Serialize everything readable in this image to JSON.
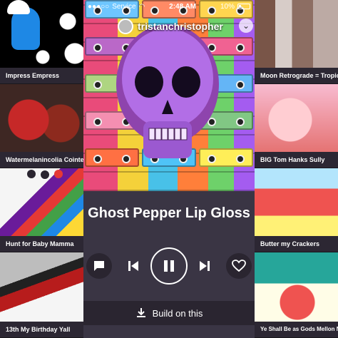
{
  "status_bar": {
    "carrier": "Service",
    "time": "2:48 AM",
    "battery": "10%"
  },
  "now_playing": {
    "username": "tristanchristopher",
    "title": "Ghost Pepper Lip Gloss",
    "build_label": "Build on this"
  },
  "icons": {
    "wifi": "wifi-icon",
    "avatar": "avatar-icon",
    "comment": "comment-icon",
    "previous": "skip-previous-icon",
    "play_pause": "pause-icon",
    "next": "skip-next-icon",
    "like": "heart-icon",
    "download": "download-icon",
    "chevron": "chevron-down-icon"
  },
  "left_tiles": [
    {
      "title": "Impress Empress",
      "colors": [
        "#1565c0",
        "#ffffff",
        "#000000"
      ]
    },
    {
      "title": "Watermelanincolia Cointel",
      "colors": [
        "#c0392b",
        "#2c1b19",
        "#e57373"
      ]
    },
    {
      "title": "Hunt for Baby Mamma",
      "colors": [
        "#6a1b9a",
        "#e53935",
        "#43a047"
      ]
    },
    {
      "title": "13th My Birthday Yall",
      "colors": [
        "#b71c1c",
        "#f5f5f5",
        "#424242"
      ]
    }
  ],
  "right_tiles": [
    {
      "title": "Moon Retrograde = Tropicoco",
      "colors": [
        "#a1887f",
        "#6d4c41",
        "#d7ccc8"
      ]
    },
    {
      "title": "BIG Tom Hanks Sully",
      "colors": [
        "#ef9a9a",
        "#c62828",
        "#fce4ec"
      ]
    },
    {
      "title": "Butter my Crackers",
      "colors": [
        "#f44336",
        "#80deea",
        "#ffeb3b"
      ]
    },
    {
      "title": "Ye Shall Be as Gods Mellon Now 'ol",
      "colors": [
        "#26a69a",
        "#ef5350",
        "#fffde7"
      ]
    }
  ],
  "accent": "#3a3544"
}
